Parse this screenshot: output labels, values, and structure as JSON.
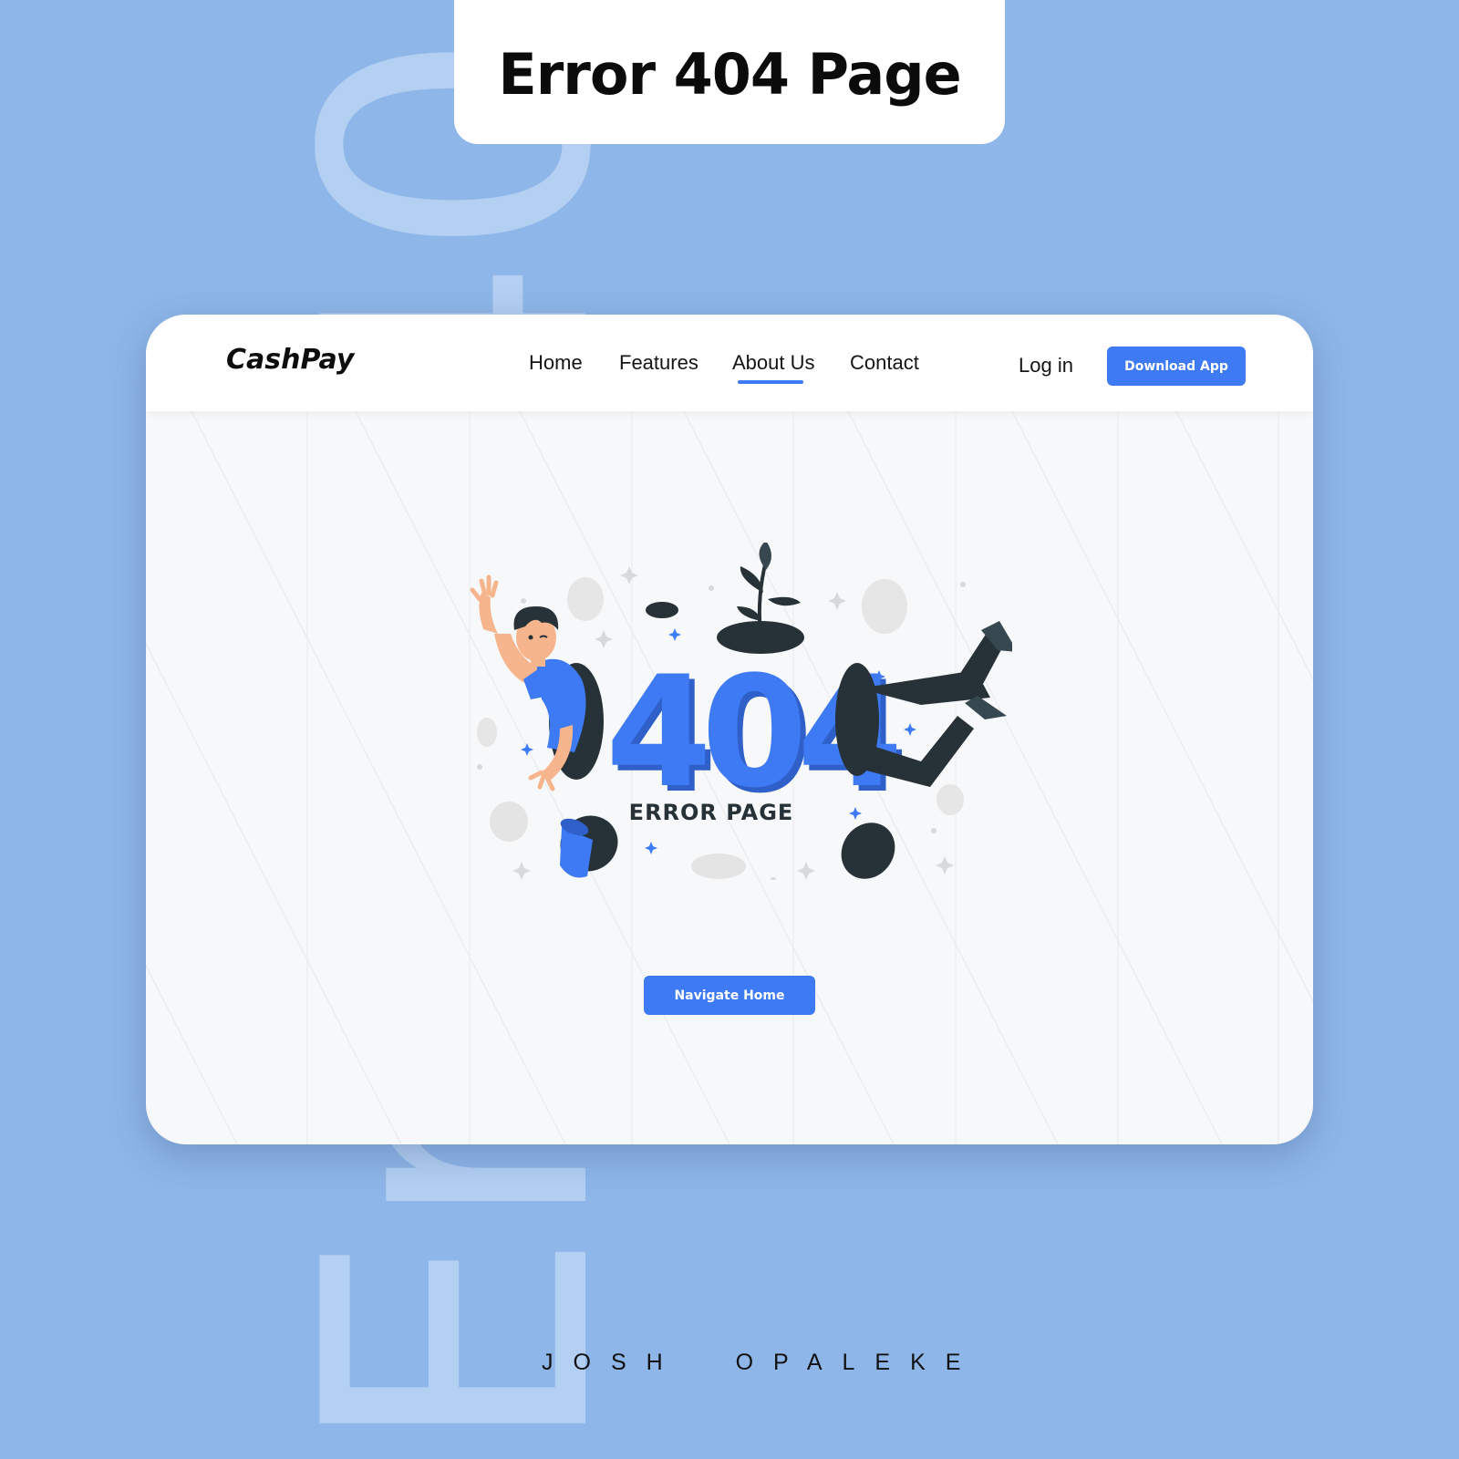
{
  "watermark": "Error 404",
  "title": "Error 404 Page",
  "navbar": {
    "logo": "CashPay",
    "links": [
      "Home",
      "Features",
      "About Us",
      "Contact"
    ],
    "active_link": "About Us",
    "login": "Log in",
    "download": "Download App"
  },
  "illustration": {
    "code": "404",
    "caption": "ERROR PAGE"
  },
  "cta": "Navigate Home",
  "author": "JOSH  OPALEKE",
  "colors": {
    "background": "#8fb6e8",
    "accent": "#3d7af3",
    "dark": "#263238"
  },
  "icons": [
    "sparkle-icon",
    "coin-icon",
    "hole-icon",
    "plant-icon",
    "hat-icon"
  ]
}
